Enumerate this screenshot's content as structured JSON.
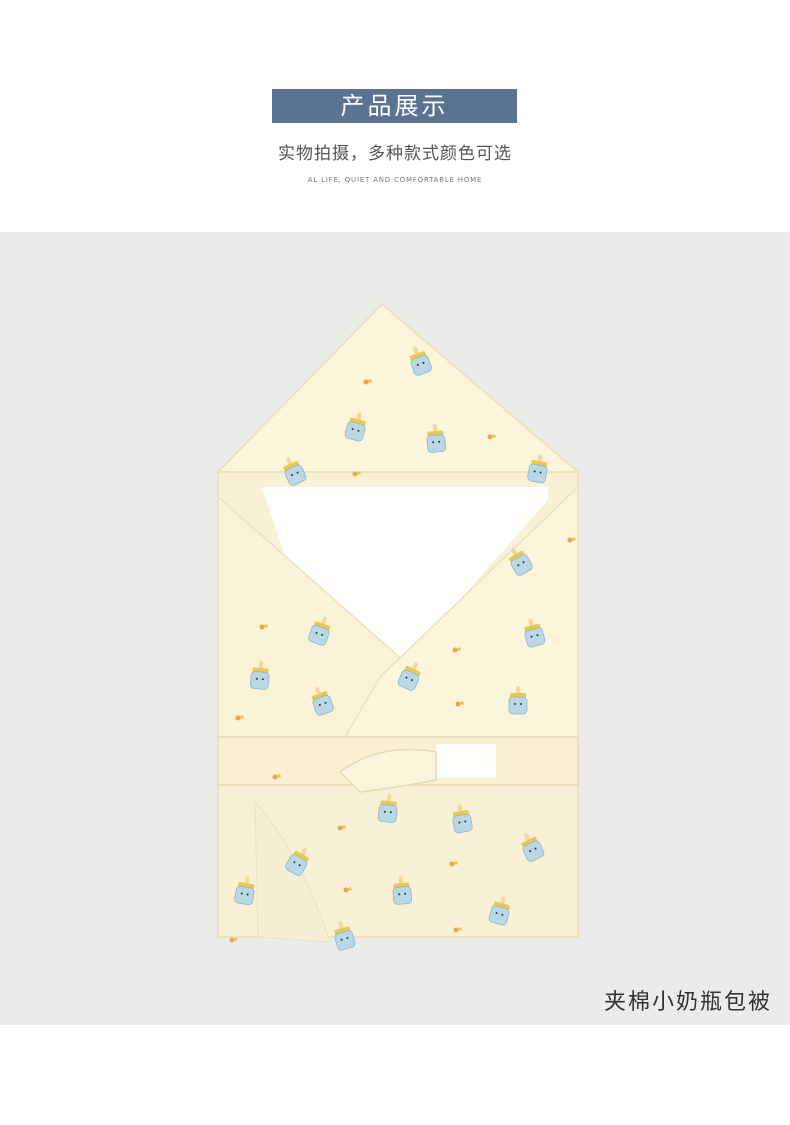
{
  "header": {
    "title": "产品展示",
    "subtitle": "实物拍摄，多种款式颜色可选",
    "tagline": "AL LIFE, QUIET AND COMFORTABLE HOME"
  },
  "product": {
    "caption": "夹棉小奶瓶包被",
    "image": "baby-swaddle-blanket-photo"
  },
  "colors": {
    "banner": "#5b7290",
    "photo_background": "#ebebea",
    "blanket": "#fbf5dc",
    "bottle_blue": "#b9d8e6",
    "bottle_yellow": "#f1c64c"
  }
}
